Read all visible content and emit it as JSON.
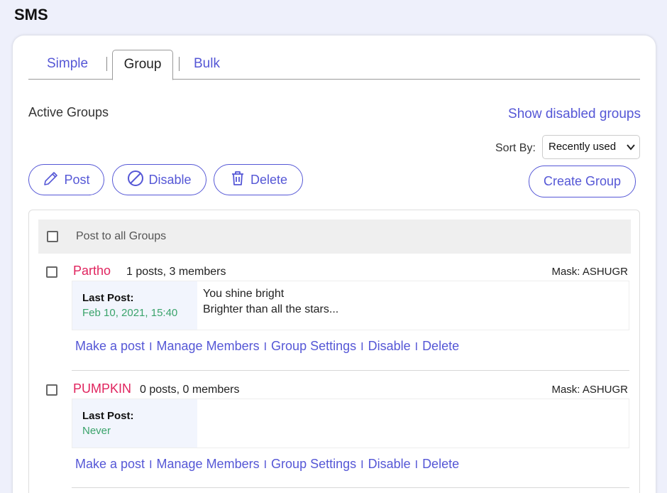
{
  "app": {
    "title": "SMS"
  },
  "tabs": {
    "simple": "Simple",
    "group": "Group",
    "bulk": "Bulk",
    "separator": "|"
  },
  "section": {
    "title": "Active Groups",
    "show_disabled": "Show disabled groups"
  },
  "sort": {
    "label": "Sort By:",
    "selected": "Recently used"
  },
  "toolbar": {
    "post": "Post",
    "disable": "Disable",
    "delete": "Delete",
    "create_group": "Create Group"
  },
  "list": {
    "all_label": "Post to all Groups",
    "groups": [
      {
        "name": "Partho",
        "meta": "1 posts, 3 members",
        "mask": "Mask: ASHUGR",
        "last_post_label": "Last Post:",
        "last_post_date": "Feb 10, 2021, 15:40",
        "message_line1": "You shine bright",
        "message_line2": "Brighter than all the stars..."
      },
      {
        "name": "PUMPKIN",
        "meta": "0 posts, 0 members",
        "mask": "Mask: ASHUGR",
        "last_post_label": "Last Post:",
        "last_post_date": "Never",
        "message_line1": "",
        "message_line2": ""
      }
    ],
    "actions": {
      "make_post": "Make a post",
      "manage_members": "Manage Members",
      "group_settings": "Group Settings",
      "disable": "Disable",
      "delete": "Delete",
      "separator": "I"
    }
  },
  "colors": {
    "accent": "#5557d6",
    "group_name": "#e0245e",
    "date": "#3aa36b",
    "background": "#eef0fb"
  }
}
